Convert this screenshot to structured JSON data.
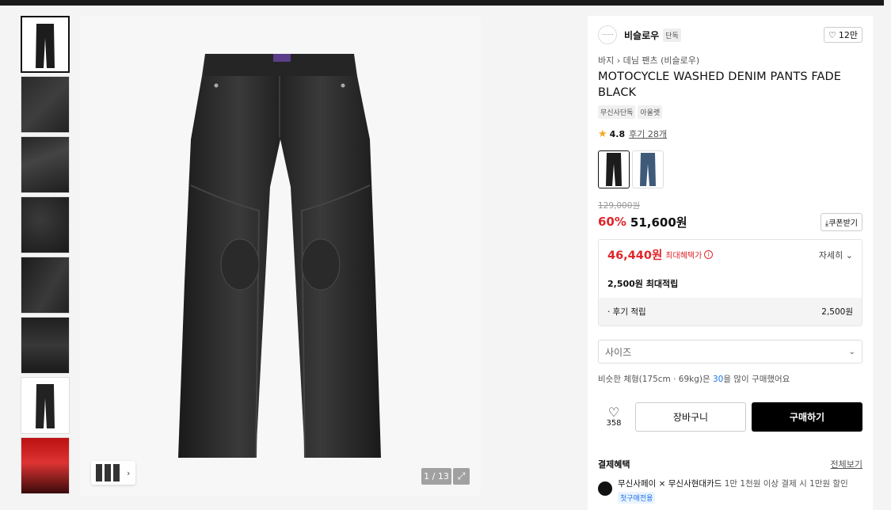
{
  "gallery": {
    "counter": "1 / 13",
    "thumbnail_count": 8
  },
  "product": {
    "brand": "비슬로우",
    "brand_logo_text": "· · · · · ·",
    "exclusive_tag": "단독",
    "likes": "12만",
    "breadcrumb": [
      "바지",
      "데님 팬츠 (비슬로우)"
    ],
    "title": "MOTOCYCLE WASHED DENIM PANTS FADE BLACK",
    "badges": [
      "무신사단독",
      "아울렛"
    ],
    "rating": "4.8",
    "review_link": "후기 28개",
    "original_price": "129,000원",
    "discount": "60%",
    "sale_price": "51,600원",
    "coupon_label": "쿠폰받기"
  },
  "benefit": {
    "max_price": "46,440원",
    "max_label": "최대혜택가",
    "detail": "자세히",
    "points": "2,500원 최대적립",
    "review_points_label": "· 후기 적립",
    "review_points_value": "2,500원"
  },
  "options": {
    "size_placeholder": "사이즈",
    "fit_prefix": "비슷한 체형(175cm · 69kg)은 ",
    "fit_number": "30",
    "fit_suffix": "을 많이 구매했어요"
  },
  "actions": {
    "wish_count": "358",
    "cart": "장바구니",
    "buy": "구매하기"
  },
  "payment": {
    "heading": "결제혜택",
    "see_all": "전체보기",
    "promo_title": "무신사페이 × 무신사현대카드",
    "promo_desc": " 1만 1천원 이상 결제 시 1만원 할인",
    "promo_badge": "첫구매전용"
  }
}
